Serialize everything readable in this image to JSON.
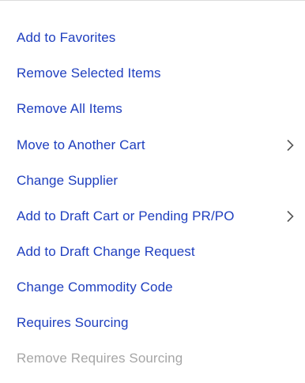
{
  "menu": {
    "items": [
      {
        "label": "Add to Favorites",
        "enabled": true,
        "submenu": false
      },
      {
        "label": "Remove Selected Items",
        "enabled": true,
        "submenu": false
      },
      {
        "label": "Remove All Items",
        "enabled": true,
        "submenu": false
      },
      {
        "label": "Move to Another Cart",
        "enabled": true,
        "submenu": true
      },
      {
        "label": "Change Supplier",
        "enabled": true,
        "submenu": false
      },
      {
        "label": "Add to Draft Cart or Pending PR/PO",
        "enabled": true,
        "submenu": true
      },
      {
        "label": "Add to Draft Change Request",
        "enabled": true,
        "submenu": false
      },
      {
        "label": "Change Commodity Code",
        "enabled": true,
        "submenu": false
      },
      {
        "label": "Requires Sourcing",
        "enabled": true,
        "submenu": false
      },
      {
        "label": "Remove Requires Sourcing",
        "enabled": false,
        "submenu": false
      }
    ],
    "submenu_icon": "chevron-right-icon",
    "colors": {
      "link": "#1f3fbf",
      "disabled": "#a6a6a6",
      "chevron": "#555555",
      "divider": "#dcdcdc"
    }
  }
}
